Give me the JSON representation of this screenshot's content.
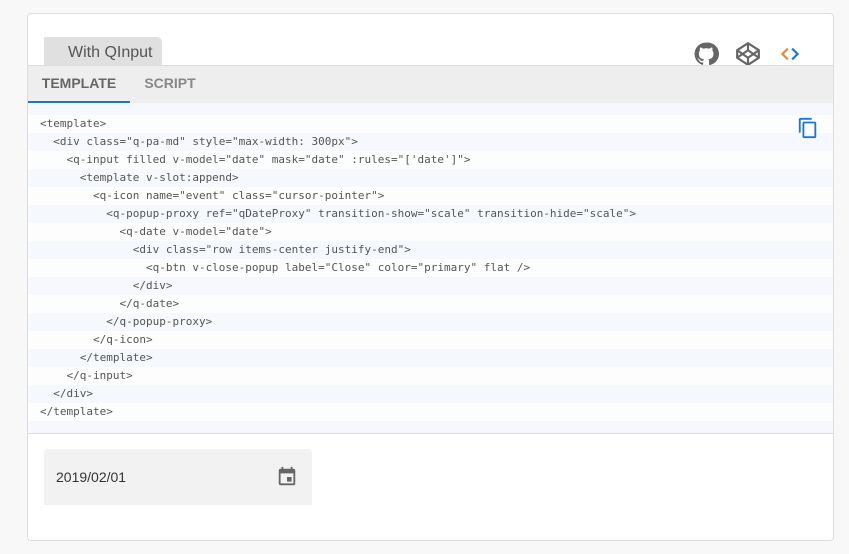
{
  "title": "With QInput",
  "tabs": [
    {
      "label": "TEMPLATE",
      "active": true
    },
    {
      "label": "SCRIPT",
      "active": false
    }
  ],
  "icons": [
    "github-icon",
    "codepen-icon",
    "code-icon",
    "copy-icon",
    "event-icon"
  ],
  "accent": "#1976d2",
  "code_lines": [
    "<template>",
    "  <div class=\"q-pa-md\" style=\"max-width: 300px\">",
    "    <q-input filled v-model=\"date\" mask=\"date\" :rules=\"['date']\">",
    "      <template v-slot:append>",
    "        <q-icon name=\"event\" class=\"cursor-pointer\">",
    "          <q-popup-proxy ref=\"qDateProxy\" transition-show=\"scale\" transition-hide=\"scale\">",
    "            <q-date v-model=\"date\">",
    "              <div class=\"row items-center justify-end\">",
    "                <q-btn v-close-popup label=\"Close\" color=\"primary\" flat />",
    "              </div>",
    "            </q-date>",
    "          </q-popup-proxy>",
    "        </q-icon>",
    "      </template>",
    "    </q-input>",
    "  </div>",
    "</template>"
  ],
  "date_input": {
    "value": "2019/02/01"
  }
}
